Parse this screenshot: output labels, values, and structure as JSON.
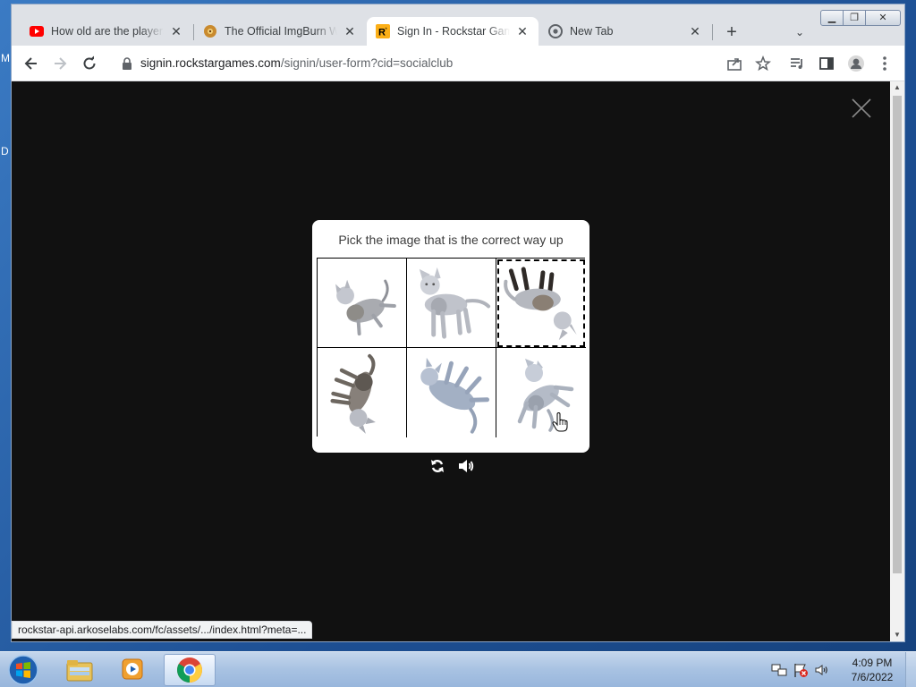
{
  "browser": {
    "tabs": [
      {
        "title": "How old are the players",
        "favicon": "youtube-icon",
        "active": false
      },
      {
        "title": "The Official ImgBurn Web",
        "favicon": "imgburn-icon",
        "active": false
      },
      {
        "title": "Sign In - Rockstar Games",
        "favicon": "rockstar-icon",
        "active": true
      },
      {
        "title": "New Tab",
        "favicon": "chrome-icon",
        "active": false
      }
    ],
    "new_tab_label": "+",
    "tab_search_label": "⌄",
    "url_host": "signin.rockstargames.com",
    "url_path": "/signin/user-form?cid=socialclub",
    "status_url": "rockstar-api.arkoselabs.com/fc/assets/.../index.html?meta=..."
  },
  "challenge": {
    "prompt": "Pick the image that is the correct way up",
    "options": [
      {
        "label": "cat tilted lying",
        "orientation": "tilted",
        "selected": false
      },
      {
        "label": "cat standing upright",
        "orientation": "upright",
        "selected": false
      },
      {
        "label": "cat upside down",
        "orientation": "upside-down",
        "selected": true
      },
      {
        "label": "cat rotated sideways",
        "orientation": "rotated",
        "selected": false
      },
      {
        "label": "cat on its back",
        "orientation": "flipped",
        "selected": false
      },
      {
        "label": "cat tilted",
        "orientation": "tilted",
        "selected": false
      }
    ],
    "controls": [
      "refresh-icon",
      "audio-icon"
    ]
  },
  "desktop": {
    "left_glyphs": [
      "M",
      "D"
    ]
  },
  "taskbar": {
    "apps": [
      "explorer-icon",
      "media-player-icon",
      "chrome-icon"
    ],
    "time": "4:09 PM",
    "date": "7/6/2022"
  },
  "colors": {
    "overlay_bg": "#111111",
    "card_bg": "#ffffff",
    "taskbar": "#a8c2e2"
  }
}
